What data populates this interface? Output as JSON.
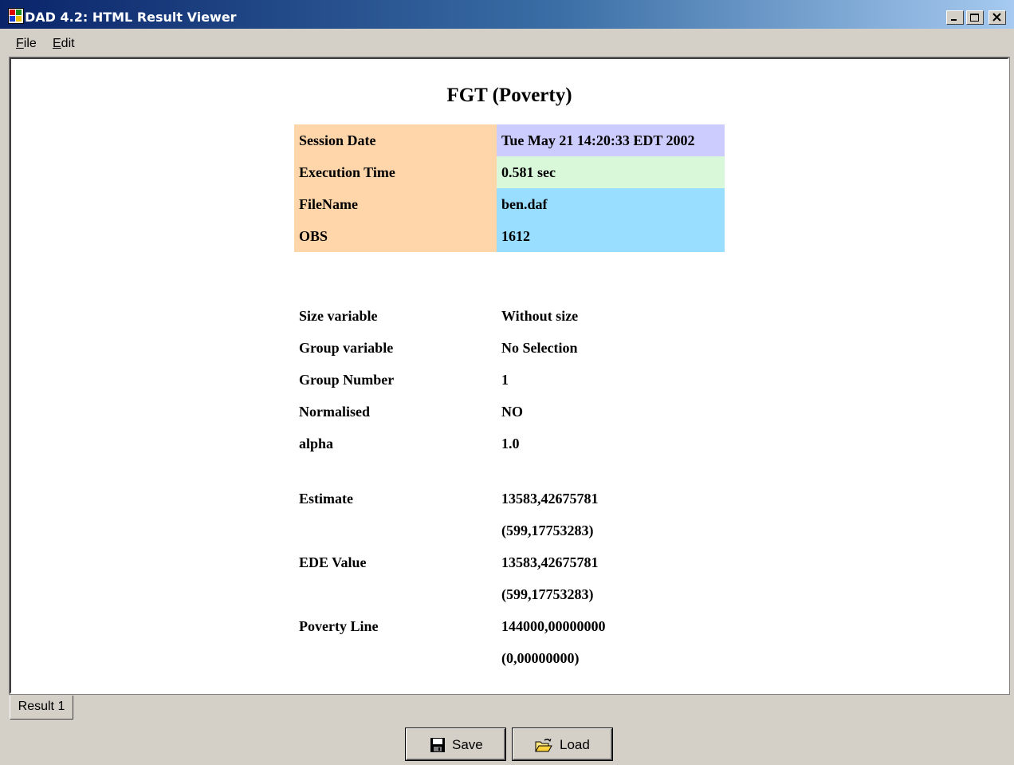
{
  "window": {
    "title": "DAD 4.2: HTML Result Viewer"
  },
  "menu": {
    "items": [
      {
        "label": "File",
        "accel": "F",
        "rest": "ile"
      },
      {
        "label": "Edit",
        "accel": "E",
        "rest": "dit"
      }
    ]
  },
  "report": {
    "title": "FGT (Poverty)",
    "session": [
      {
        "label": "Session Date",
        "value": "Tue May 21 14:20:33 EDT 2002",
        "color": "#ccccff"
      },
      {
        "label": "Execution Time",
        "value": "0.581 sec",
        "color": "#d9f7d9"
      },
      {
        "label": "FileName",
        "value": "ben.daf",
        "color": "#99ddff"
      },
      {
        "label": "OBS",
        "value": "1612",
        "color": "#99ddff"
      }
    ],
    "label_color": "#ffd5aa",
    "params": [
      {
        "label": "Size variable",
        "value": "Without size"
      },
      {
        "label": "Group variable",
        "value": "No Selection"
      },
      {
        "label": "Group Number",
        "value": "1"
      },
      {
        "label": "Normalised",
        "value": "NO"
      },
      {
        "label": "alpha",
        "value": "1.0"
      }
    ],
    "results": [
      {
        "label": "Estimate",
        "value": "13583,42675781"
      },
      {
        "label": "",
        "value": "(599,17753283)"
      },
      {
        "label": "EDE Value",
        "value": "13583,42675781"
      },
      {
        "label": "",
        "value": "(599,17753283)"
      },
      {
        "label": "Poverty Line",
        "value": "144000,00000000"
      },
      {
        "label": "",
        "value": "(0,00000000)"
      }
    ]
  },
  "tabs": [
    {
      "label": "Result 1"
    }
  ],
  "buttons": {
    "save": "Save",
    "load": "Load"
  }
}
